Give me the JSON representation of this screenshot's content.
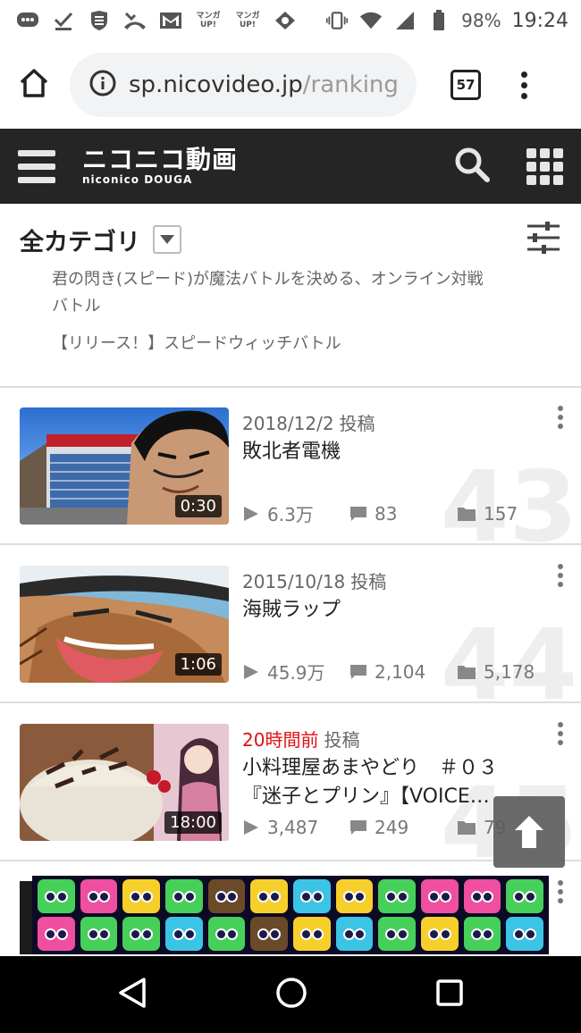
{
  "status_bar": {
    "battery": "98%",
    "time": "19:24",
    "manga_label_1": "マンガ UP!",
    "manga_label_2": "マンガ UP!"
  },
  "browser": {
    "url_main": "sp.nicovideo.jp",
    "url_path": "/ranking",
    "tab_count": "57"
  },
  "header": {
    "logo_main": "ニコニコ動画",
    "logo_sub": "niconico DOUGA"
  },
  "category": {
    "title": "全カテゴリ"
  },
  "description": {
    "line1": "君の閃き(スピード)が魔法バトルを決める、オンライン対戦",
    "line2": "バトル",
    "line3": "【リリース！】スピードウィッチバトル"
  },
  "videos": [
    {
      "rank": "43",
      "date": "2018/12/2",
      "posted_label": "投稿",
      "title": "敗北者電機",
      "duration": "0:30",
      "views": "6.3万",
      "comments": "83",
      "mylists": "157",
      "recent": false
    },
    {
      "rank": "44",
      "date": "2015/10/18",
      "posted_label": "投稿",
      "title": "海賊ラップ",
      "duration": "1:06",
      "views": "45.9万",
      "comments": "2,104",
      "mylists": "5,178",
      "recent": false
    },
    {
      "rank": "45",
      "date": "20時間前",
      "posted_label": "投稿",
      "title": "小料理屋あまやどり　＃０３『迷子とプリン』【VOICE…",
      "duration": "18:00",
      "views": "3,487",
      "comments": "249",
      "mylists": "79",
      "recent": true
    }
  ],
  "colors": {
    "header_bg": "#252525",
    "recent_red": "#dd1111",
    "stat_gray": "#777777"
  }
}
